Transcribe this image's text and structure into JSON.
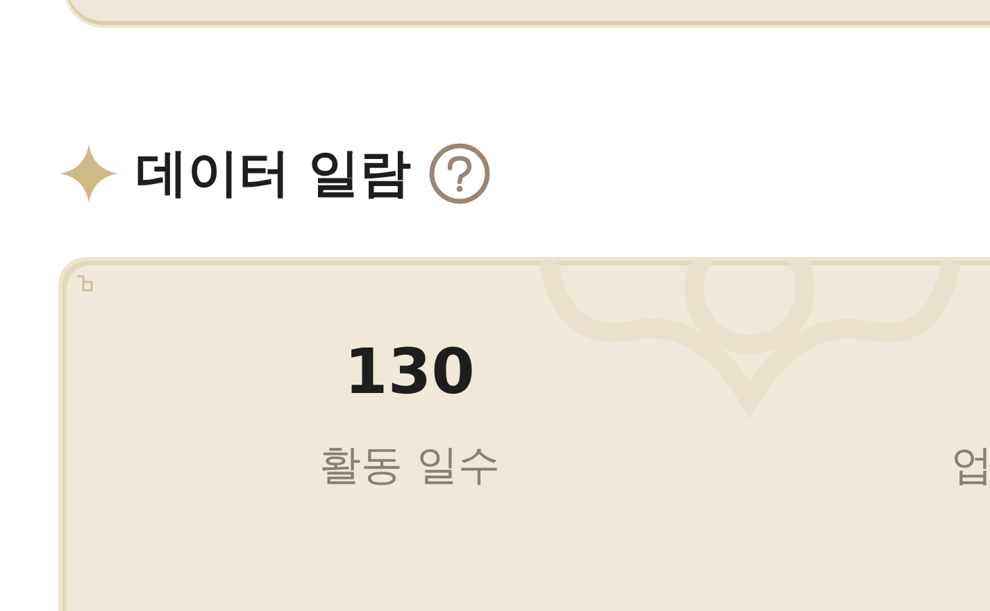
{
  "section": {
    "title": "데이터 일람"
  },
  "stats": [
    {
      "value": "130",
      "label": "활동 일수"
    },
    {
      "label": "업"
    }
  ]
}
